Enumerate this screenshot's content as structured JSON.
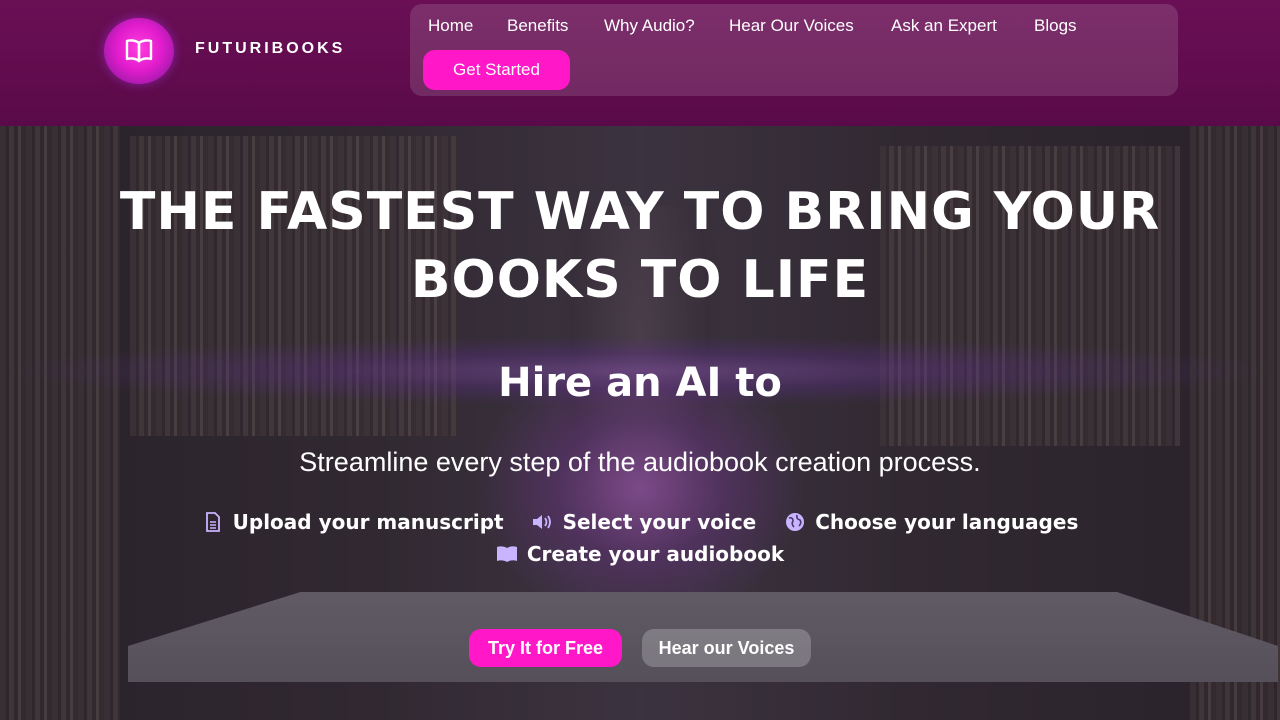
{
  "brand": {
    "name": "FUTURIBOOKS",
    "accent": "#ff17c8",
    "header_bg": "#5e0b4d",
    "logo_icon": "open-book-icon"
  },
  "nav": {
    "links": [
      "Home",
      "Benefits",
      "Why Audio?",
      "Hear Our Voices",
      "Ask an Expert",
      "Blogs"
    ],
    "cta": "Get Started"
  },
  "hero": {
    "title_line1": "THE FASTEST WAY TO BRING YOUR",
    "title_line2": "BOOKS TO LIFE",
    "subtitle": "Hire an AI to",
    "description": "Streamline every step of the audiobook creation process.",
    "steps": [
      {
        "icon": "document-icon",
        "label": "Upload your manuscript"
      },
      {
        "icon": "speaker-icon",
        "label": "Select your voice"
      },
      {
        "icon": "globe-icon",
        "label": "Choose your languages"
      },
      {
        "icon": "book-icon",
        "label": "Create your audiobook"
      }
    ],
    "primary_cta": "Try It for Free",
    "secondary_cta": "Hear our Voices"
  }
}
